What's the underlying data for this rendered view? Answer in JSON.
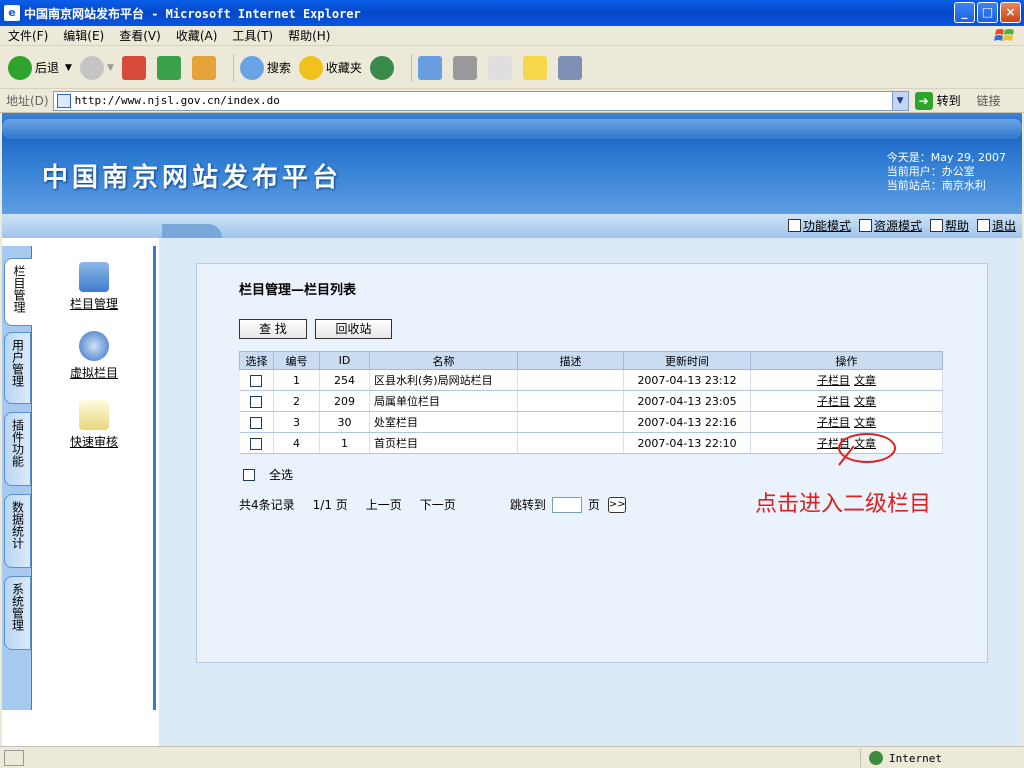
{
  "window": {
    "title": "中国南京网站发布平台 - Microsoft Internet Explorer",
    "btn_min": "_",
    "btn_max": "□",
    "btn_close": "×"
  },
  "menu": [
    "文件(F)",
    "编辑(E)",
    "查看(V)",
    "收藏(A)",
    "工具(T)",
    "帮助(H)"
  ],
  "toolbar": {
    "back": "后退",
    "search": "搜索",
    "favorites": "收藏夹"
  },
  "address": {
    "label": "地址(D)",
    "url": "http://www.njsl.gov.cn/index.do",
    "go": "转到",
    "links": "链接"
  },
  "banner": {
    "title": "中国南京网站发布平台",
    "today": "今天是：May 29, 2007",
    "user": "当前用户：办公室",
    "site": "当前站点：南京水利",
    "nav": [
      "功能模式",
      "资源模式",
      "帮助",
      "退出"
    ]
  },
  "vtabs": [
    "栏目管理",
    "用户管理",
    "插件功能",
    "数据统计",
    "系统管理"
  ],
  "side_items": [
    "栏目管理",
    "虚拟栏目",
    "快速审核"
  ],
  "panel": {
    "title": "栏目管理—栏目列表",
    "btn_search": "查 找",
    "btn_recycle": "回收站",
    "headers": [
      "选择",
      "编号",
      "ID",
      "名称",
      "描述",
      "更新时间",
      "操作"
    ],
    "rows": [
      {
        "no": "1",
        "id": "254",
        "name": "区县水利(务)局网站栏目",
        "desc": "",
        "time": "2007-04-13 23:12"
      },
      {
        "no": "2",
        "id": "209",
        "name": "局属单位栏目",
        "desc": "",
        "time": "2007-04-13 23:05"
      },
      {
        "no": "3",
        "id": "30",
        "name": "处室栏目",
        "desc": "",
        "time": "2007-04-13 22:16"
      },
      {
        "no": "4",
        "id": "1",
        "name": "首页栏目",
        "desc": "",
        "time": "2007-04-13 22:10"
      }
    ],
    "op_sub": "子栏目",
    "op_article": "文章",
    "select_all": "全选",
    "pager": {
      "total": "共4条记录",
      "pages": "1/1 页",
      "prev": "上一页",
      "next": "下一页",
      "jump": "跳转到",
      "page_unit": "页",
      "go": ">>"
    }
  },
  "annotation": "点击进入二级栏目",
  "status": {
    "zone": "Internet"
  }
}
